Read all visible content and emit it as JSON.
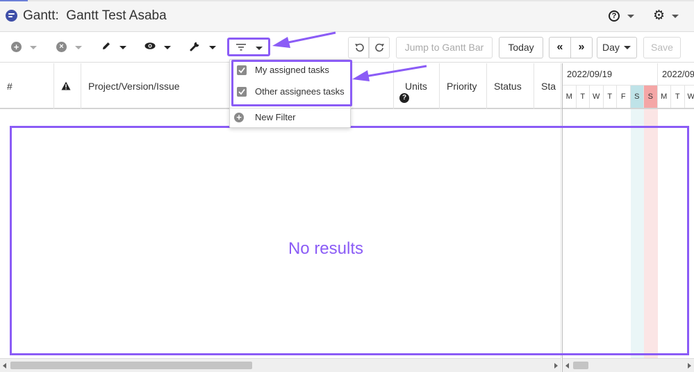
{
  "window": {
    "title": "Gantt:  Gantt Test Asaba"
  },
  "header": {
    "help_icon": "question-circle-icon",
    "settings_icon": "gear-icon"
  },
  "toolbar": {
    "add_icon": "plus-circle-icon",
    "delete_icon": "x-circle-icon",
    "edit_icon": "pencil-icon",
    "view_icon": "eye-icon",
    "tools_icon": "wrench-icon",
    "filter_icon": "filter-icon",
    "undo_icon": "undo-icon",
    "redo_icon": "redo-icon",
    "jump_label": "Jump to Gantt Bar",
    "today_label": "Today",
    "prev_label": "«",
    "next_label": "»",
    "zoom_value": "Day",
    "save_label": "Save"
  },
  "filter_menu": {
    "items": [
      {
        "label": "My assigned tasks",
        "checked": true
      },
      {
        "label": "Other assignees tasks",
        "checked": true
      }
    ],
    "new_filter_label": "New Filter"
  },
  "grid": {
    "columns": [
      "#",
      "",
      "Project/Version/Issue",
      "Units",
      "Priority",
      "Status",
      "Sta"
    ],
    "warning_icon": "warning-triangle-icon",
    "units_help_icon": "question-circle-icon",
    "empty_message": "No results"
  },
  "timeline": {
    "weeks": [
      "2022/09/19",
      "2022/09"
    ],
    "days": [
      "M",
      "T",
      "W",
      "T",
      "F",
      "S",
      "S",
      "M",
      "T",
      "W"
    ]
  },
  "colors": {
    "highlight": "#8b5cf6",
    "saturday": "#bfe3e8",
    "sunday": "#f4a6a6"
  }
}
